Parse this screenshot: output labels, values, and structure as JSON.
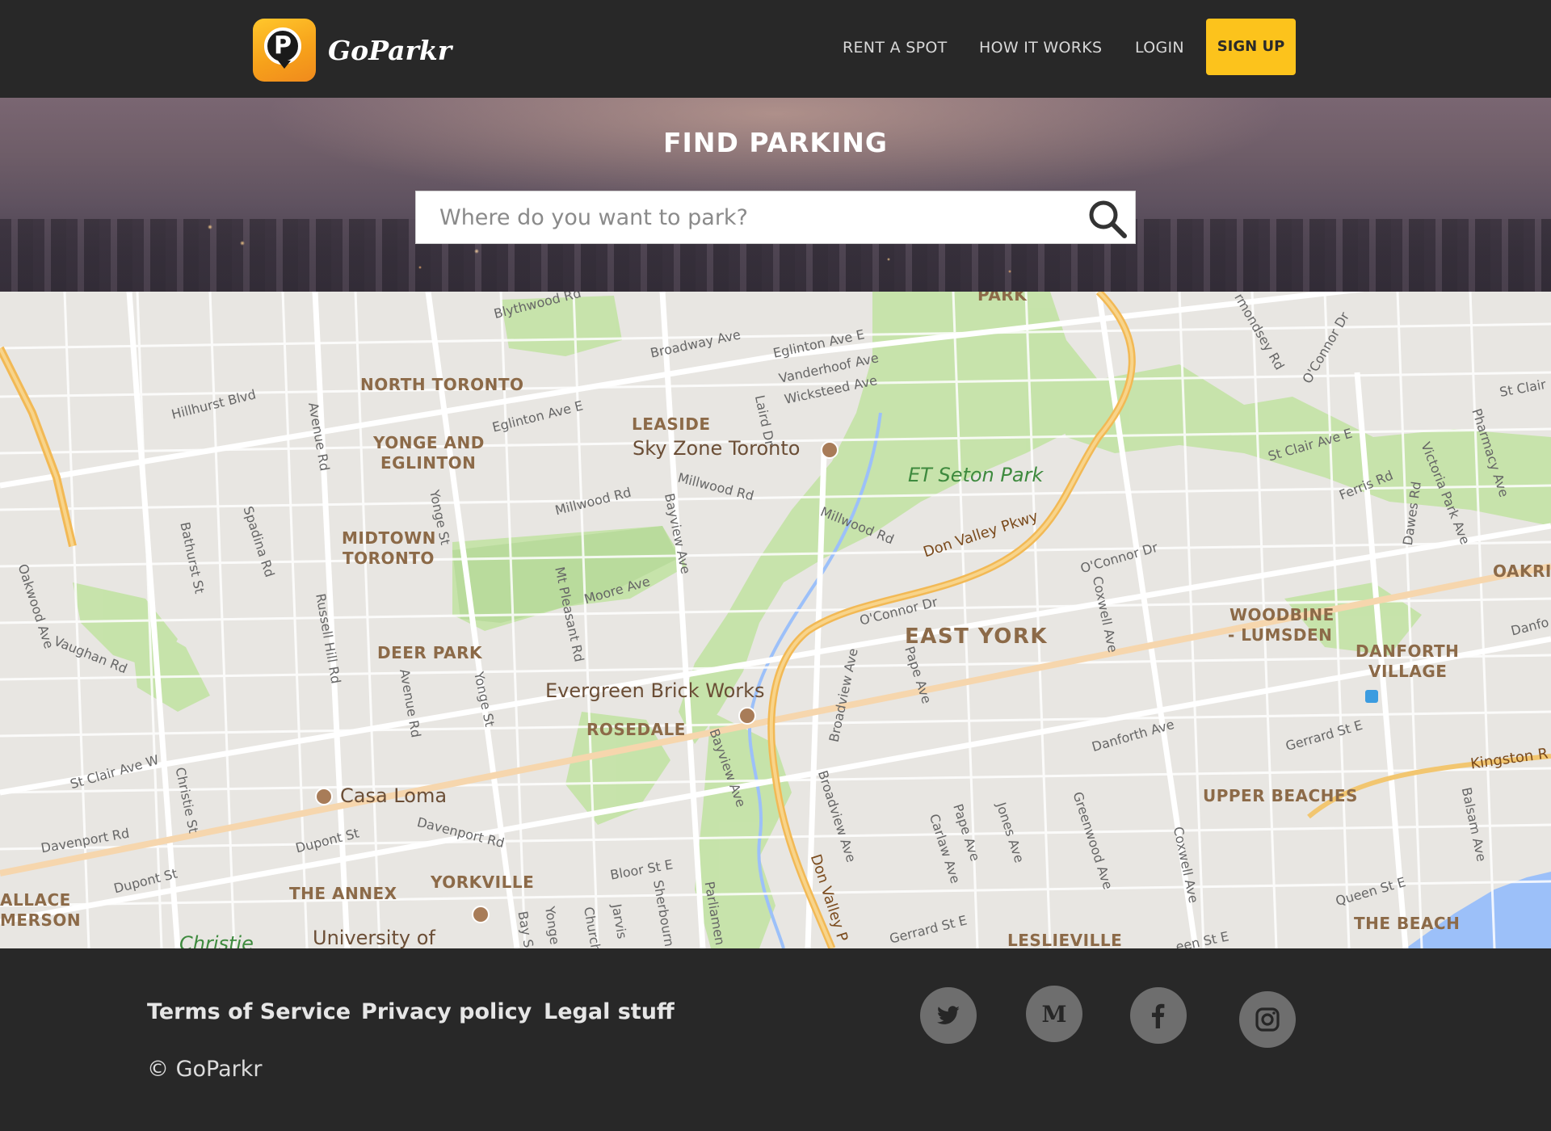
{
  "header": {
    "brand": "GoParkr",
    "logo_letter": "P",
    "nav": {
      "rent": "RENT A SPOT",
      "how": "HOW IT WORKS",
      "login": "LOGIN",
      "signup": "SIGN UP"
    }
  },
  "hero": {
    "title": "FIND PARKING",
    "search_placeholder": "Where do you want to park?"
  },
  "map": {
    "areas": {
      "north_toronto": "NORTH TORONTO",
      "yonge_eglinton_1": "YONGE AND",
      "yonge_eglinton_2": "EGLINTON",
      "midtown_1": "MIDTOWN",
      "midtown_2": "TORONTO",
      "leaside": "LEASIDE",
      "deer_park": "DEER PARK",
      "rosedale": "ROSEDALE",
      "east_york": "EAST YORK",
      "woodbine_1": "WOODBINE",
      "woodbine_2": "- LUMSDEN",
      "danforth_1": "DANFORTH",
      "danforth_2": "VILLAGE",
      "upper_beaches": "UPPER BEACHES",
      "the_annex": "THE ANNEX",
      "yorkville": "YORKVILLE",
      "the_beach": "THE BEACH",
      "leslieville": "LESLIEVILLE",
      "park": "PARK",
      "oakridge": "OAKRI",
      "wallace_1": "ALLACE",
      "wallace_2": "MERSON"
    },
    "pois": {
      "sky_zone": "Sky Zone Toronto",
      "evergreen": "Evergreen Brick Works",
      "casa_loma": "Casa Loma",
      "university": "University of",
      "christie": "Christie"
    },
    "parks": {
      "et_seton": "ET Seton Park"
    },
    "highways": {
      "dvp1": "Don Valley Pkwy",
      "dvp2": "Don Valley P",
      "kingston": "Kingston R"
    },
    "streets": {
      "broadway": "Broadway Ave",
      "eglinton_e1": "Eglinton Ave E",
      "eglinton_e2": "Eglinton Ave E",
      "vanderhoof": "Vanderhoof Ave",
      "wicksteed": "Wicksteed Ave",
      "laird": "Laird Dr",
      "hillhurst": "Hillhurst Blvd",
      "avenue_rd": "Avenue Rd",
      "avenue_rd2": "Avenue Rd",
      "millwood1": "Millwood Rd",
      "millwood2": "Millwood Rd",
      "millwood3": "Millwood Rd",
      "bayview": "Bayview Ave",
      "bayview2": "Bayview Ave",
      "yonge1": "Yonge St",
      "yonge2": "Yonge St",
      "yonge3": "Yonge",
      "spadina": "Spadina Rd",
      "bathurst": "Bathurst St",
      "moore": "Moore Ave",
      "mt_pleasant": "Mt Pleasant Rd",
      "oconnor1": "O'Connor Dr",
      "oconnor2": "O'Connor Dr",
      "oconnor3": "O'Connor Dr",
      "coxwell1": "Coxwell Ave",
      "coxwell2": "Coxwell Ave",
      "broadview1": "Broadview Ave",
      "broadview2": "Broadview Ave",
      "pape1": "Pape Ave",
      "pape2": "Pape Ave",
      "danforth": "Danforth Ave",
      "gerrard1": "Gerrard St E",
      "gerrard2": "Gerrard St E",
      "st_clair_w": "St Clair Ave W",
      "st_clair_e": "St Clair Ave E",
      "st_clair": "St Clair",
      "christie": "Christie St",
      "davenport1": "Davenport Rd",
      "davenport2": "Davenport Rd",
      "dupont1": "Dupont St",
      "dupont2": "Dupont St",
      "bloor": "Bloor St E",
      "russell": "Russell Hill Rd",
      "oakwood": "Oakwood Ave",
      "vaughan": "Vaughan Rd",
      "ferris": "Ferris Rd",
      "dawes": "Dawes Rd",
      "victoria_park": "Victoria Park Ave",
      "pharmacy": "Pharmacy Ave",
      "bermondsey": "rmondsey Rd",
      "queen1": "Queen St E",
      "queen2": "een St E",
      "jones": "Jones Ave",
      "greenwood": "Greenwood Ave",
      "carlaw": "Carlaw Ave",
      "sherbourne": "Sherbourn",
      "jarvis": "Jarvis",
      "church": "Church",
      "bay": "Bay S",
      "parliament": "Parliamen",
      "balsam": "Balsam Ave",
      "blythwood": "Blythwood Rd",
      "danforth_r": "Danfo"
    }
  },
  "footer": {
    "tos": "Terms of Service",
    "privacy": "Privacy policy",
    "legal": "Legal stuff",
    "copyright": "© GoParkr"
  },
  "colors": {
    "dark_bg": "#282828",
    "accent": "#fcc31c",
    "social_bg": "#6e6e6e"
  }
}
